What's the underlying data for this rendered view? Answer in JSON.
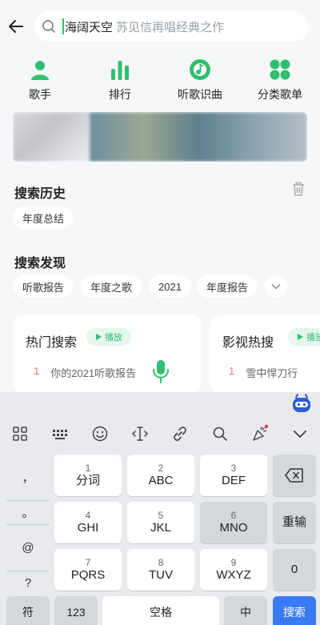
{
  "search": {
    "query": "海阔天空",
    "placeholder_hint": "苏见信再唱经典之作"
  },
  "quick_nav": [
    {
      "label": "歌手",
      "icon": "singer-icon"
    },
    {
      "label": "排行",
      "icon": "chart-bars-icon"
    },
    {
      "label": "听歌识曲",
      "icon": "music-recognize-icon"
    },
    {
      "label": "分类歌单",
      "icon": "category-grid-icon"
    }
  ],
  "history": {
    "title": "搜索历史",
    "items": [
      "年度总结"
    ]
  },
  "discover": {
    "title": "搜索发现",
    "items": [
      "听歌报告",
      "年度之歌",
      "2021",
      "年度报告"
    ]
  },
  "cards": [
    {
      "title": "热门搜索",
      "play": "播放",
      "rank": "1",
      "text": "你的2021听歌报告"
    },
    {
      "title": "影视热搜",
      "play": "播放",
      "rank": "1",
      "text": "雪中悍刀行"
    }
  ],
  "keyboard": {
    "symbols": [
      "，",
      "。",
      "@",
      "?"
    ],
    "keys": [
      {
        "digit": "1",
        "letters": "分词"
      },
      {
        "digit": "2",
        "letters": "ABC"
      },
      {
        "digit": "3",
        "letters": "DEF"
      },
      {
        "digit": "4",
        "letters": "GHI"
      },
      {
        "digit": "5",
        "letters": "JKL"
      },
      {
        "digit": "6",
        "letters": "MNO"
      },
      {
        "digit": "7",
        "letters": "PQRS"
      },
      {
        "digit": "8",
        "letters": "TUV"
      },
      {
        "digit": "9",
        "letters": "WXYZ"
      }
    ],
    "reenter": "重输",
    "zero": "0",
    "symbol_key": "符",
    "num_key": "123",
    "space": "空格",
    "lang": "中",
    "search": "搜索"
  },
  "colors": {
    "accent": "#2fbf6f",
    "key_blue": "#3a7bf3"
  }
}
